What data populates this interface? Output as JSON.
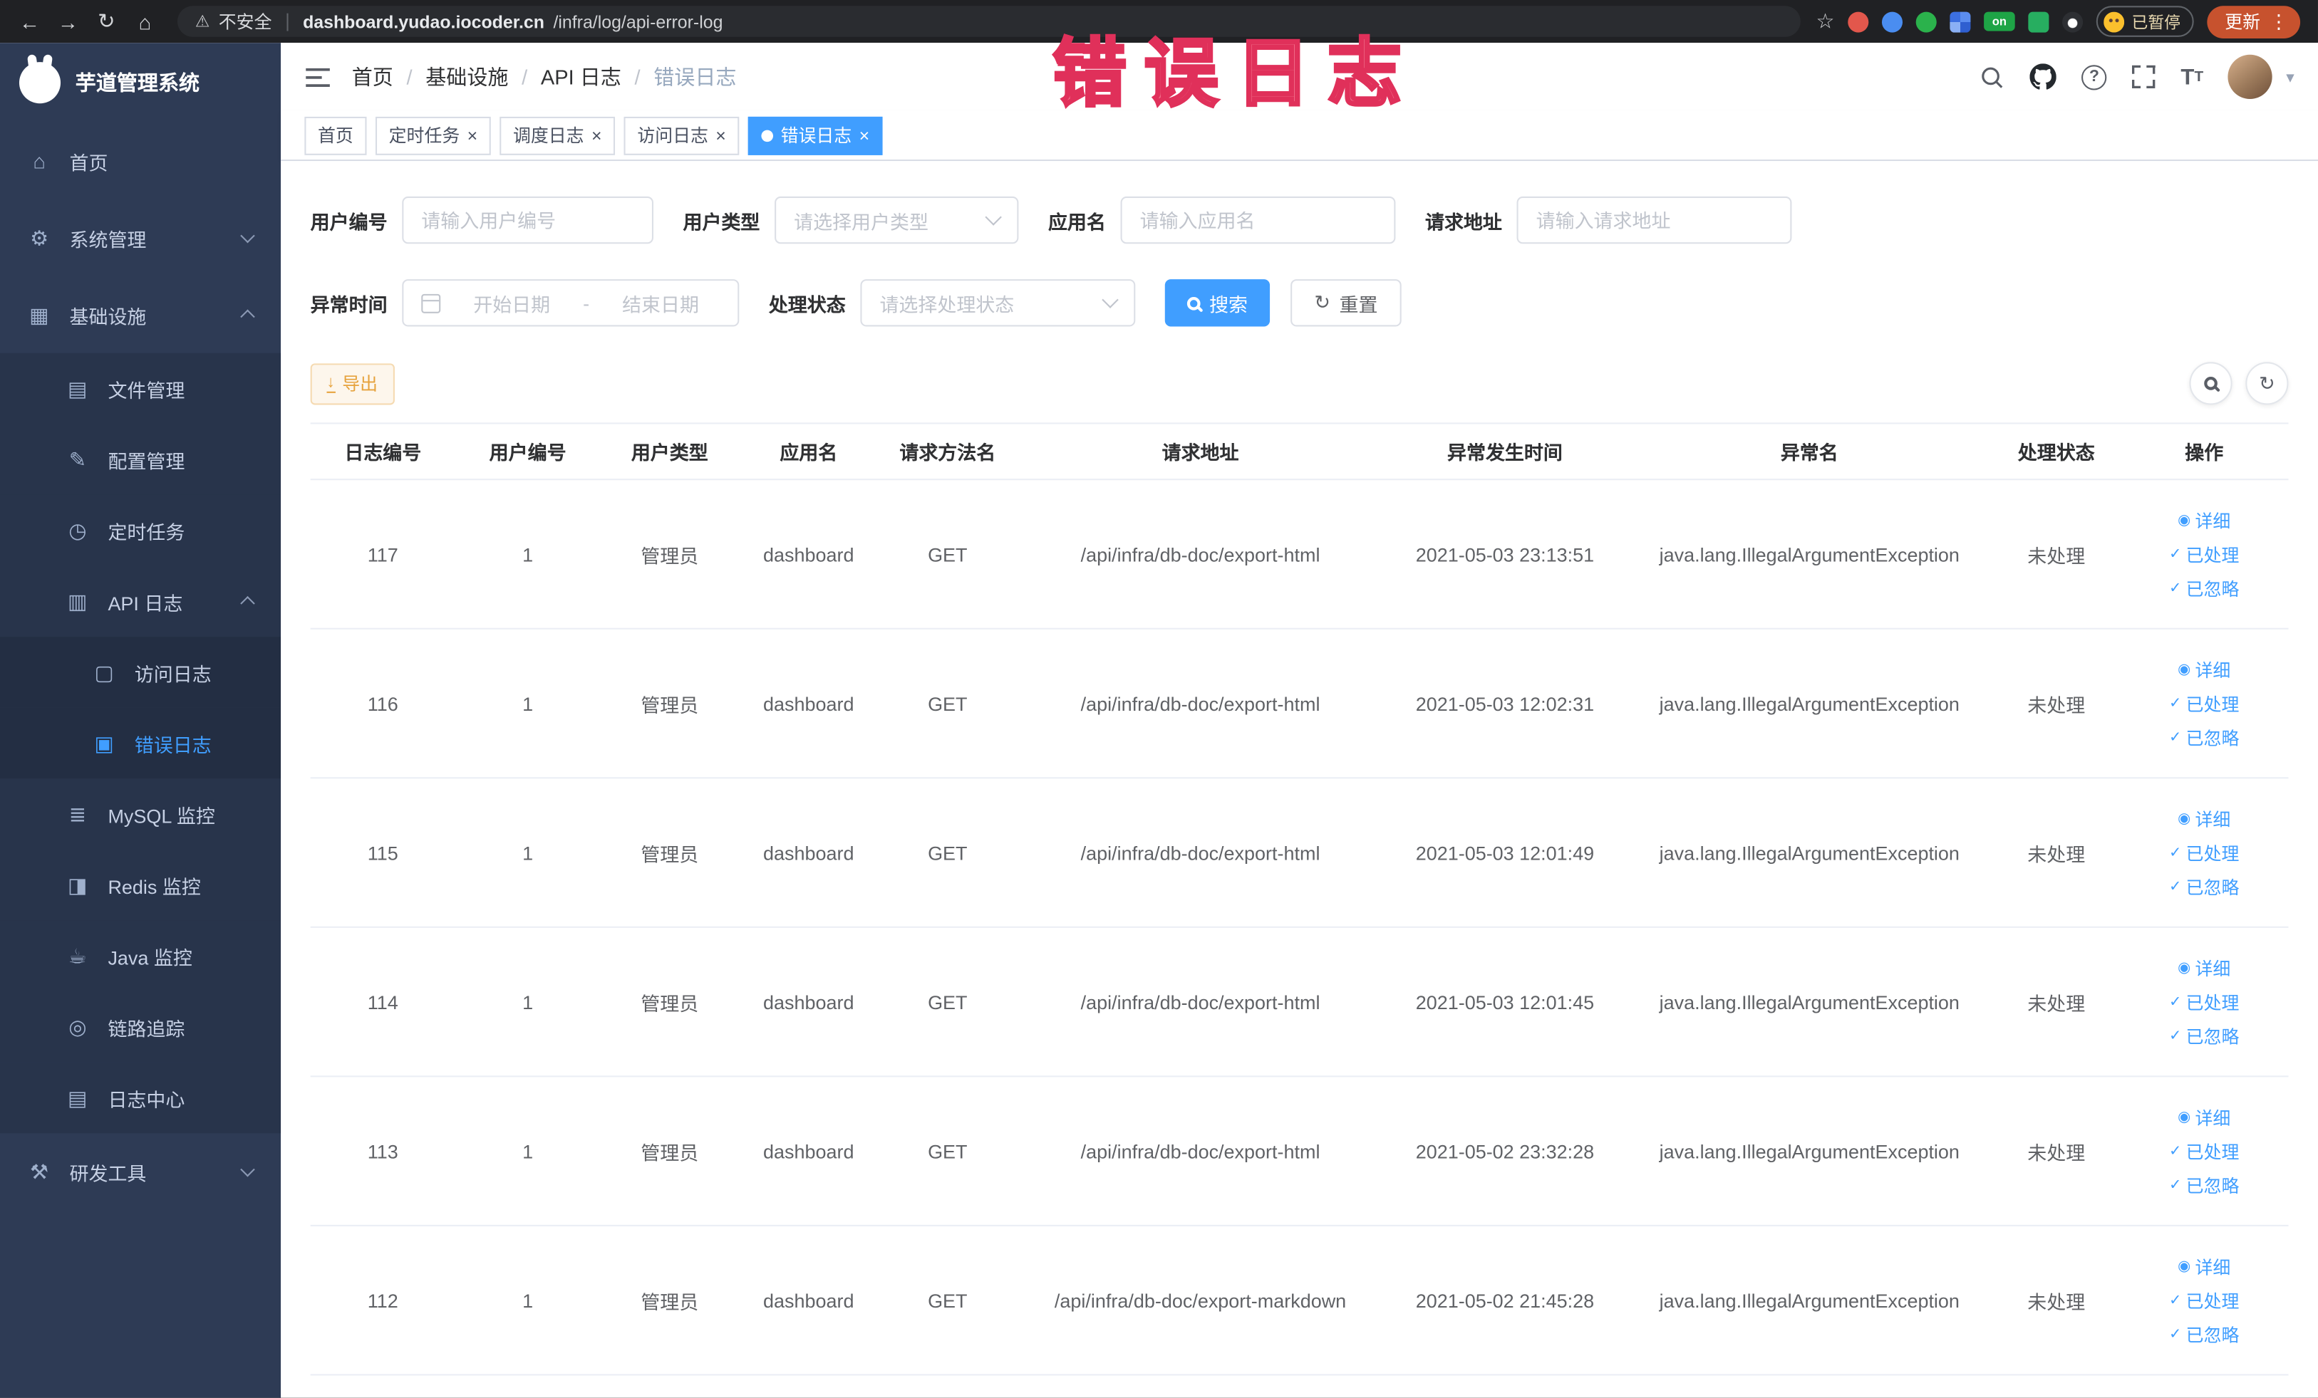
{
  "browser": {
    "security_label": "不安全",
    "url_domain": "dashboard.yudao.iocoder.cn",
    "url_path": "/infra/log/api-error-log",
    "extension_badge": "on",
    "profile_status": "已暂停",
    "update_label": "更新"
  },
  "annotation": {
    "text": "错误日志"
  },
  "colors": {
    "accent": "#409eff",
    "sidebar_bg": "#2e3b55",
    "warning": "#e6a23c",
    "annotation": "#e0305a"
  },
  "icons": {
    "back": "←",
    "forward": "→",
    "reload": "↻",
    "home": "⌂",
    "warning": "⚠",
    "star": "☆",
    "dots": "⋮",
    "system": "⚙",
    "infra": "▦",
    "file": "▤",
    "config": "✎",
    "job": "◷",
    "apilog": "▥",
    "access": "▢",
    "error": "▣",
    "mysql": "≣",
    "redis": "◨",
    "java": "☕",
    "trace": "◎",
    "logcenter": "▤",
    "tools": "⚒",
    "view": "◉",
    "check": "✓",
    "close": "×",
    "caret_down": "▾",
    "help": "?",
    "fontsize": "T",
    "download": "↓"
  },
  "sidebar": {
    "title": "芋道管理系统",
    "items": [
      {
        "label": "首页"
      },
      {
        "label": "系统管理"
      },
      {
        "label": "基础设施"
      },
      {
        "label": "文件管理"
      },
      {
        "label": "配置管理"
      },
      {
        "label": "定时任务"
      },
      {
        "label": "API 日志"
      },
      {
        "label": "访问日志"
      },
      {
        "label": "错误日志"
      },
      {
        "label": "MySQL 监控"
      },
      {
        "label": "Redis 监控"
      },
      {
        "label": "Java 监控"
      },
      {
        "label": "链路追踪"
      },
      {
        "label": "日志中心"
      },
      {
        "label": "研发工具"
      }
    ]
  },
  "breadcrumb": {
    "separator": "/",
    "items": [
      "首页",
      "基础设施",
      "API 日志",
      "错误日志"
    ]
  },
  "tabs": [
    {
      "label": "首页"
    },
    {
      "label": "定时任务"
    },
    {
      "label": "调度日志"
    },
    {
      "label": "访问日志"
    },
    {
      "label": "错误日志"
    }
  ],
  "filters": {
    "user_id": {
      "label": "用户编号",
      "placeholder": "请输入用户编号"
    },
    "user_type": {
      "label": "用户类型",
      "placeholder": "请选择用户类型"
    },
    "app_name": {
      "label": "应用名",
      "placeholder": "请输入应用名"
    },
    "request_url": {
      "label": "请求地址",
      "placeholder": "请输入请求地址"
    },
    "exception_time": {
      "label": "异常时间",
      "start_placeholder": "开始日期",
      "separator": "-",
      "end_placeholder": "结束日期"
    },
    "process_status": {
      "label": "处理状态",
      "placeholder": "请选择处理状态"
    },
    "search_label": "搜索",
    "reset_label": "重置"
  },
  "toolbar": {
    "export_label": "导出"
  },
  "table": {
    "columns": [
      "日志编号",
      "用户编号",
      "用户类型",
      "应用名",
      "请求方法名",
      "请求地址",
      "异常发生时间",
      "异常名",
      "处理状态",
      "操作"
    ],
    "rows": [
      {
        "id": "117",
        "user_id": "1",
        "user_type": "管理员",
        "app_name": "dashboard",
        "method": "GET",
        "url": "/api/infra/db-doc/export-html",
        "time": "2021-05-03 23:13:51",
        "exception": "java.lang.IllegalArgumentException",
        "status": "未处理"
      },
      {
        "id": "116",
        "user_id": "1",
        "user_type": "管理员",
        "app_name": "dashboard",
        "method": "GET",
        "url": "/api/infra/db-doc/export-html",
        "time": "2021-05-03 12:02:31",
        "exception": "java.lang.IllegalArgumentException",
        "status": "未处理"
      },
      {
        "id": "115",
        "user_id": "1",
        "user_type": "管理员",
        "app_name": "dashboard",
        "method": "GET",
        "url": "/api/infra/db-doc/export-html",
        "time": "2021-05-03 12:01:49",
        "exception": "java.lang.IllegalArgumentException",
        "status": "未处理"
      },
      {
        "id": "114",
        "user_id": "1",
        "user_type": "管理员",
        "app_name": "dashboard",
        "method": "GET",
        "url": "/api/infra/db-doc/export-html",
        "time": "2021-05-03 12:01:45",
        "exception": "java.lang.IllegalArgumentException",
        "status": "未处理"
      },
      {
        "id": "113",
        "user_id": "1",
        "user_type": "管理员",
        "app_name": "dashboard",
        "method": "GET",
        "url": "/api/infra/db-doc/export-html",
        "time": "2021-05-02 23:32:28",
        "exception": "java.lang.IllegalArgumentException",
        "status": "未处理"
      },
      {
        "id": "112",
        "user_id": "1",
        "user_type": "管理员",
        "app_name": "dashboard",
        "method": "GET",
        "url": "/api/infra/db-doc/export-markdown",
        "time": "2021-05-02 21:45:28",
        "exception": "java.lang.IllegalArgumentException",
        "status": "未处理"
      }
    ]
  },
  "actions": {
    "detail": "详细",
    "processed": "已处理",
    "ignored": "已忽略"
  }
}
